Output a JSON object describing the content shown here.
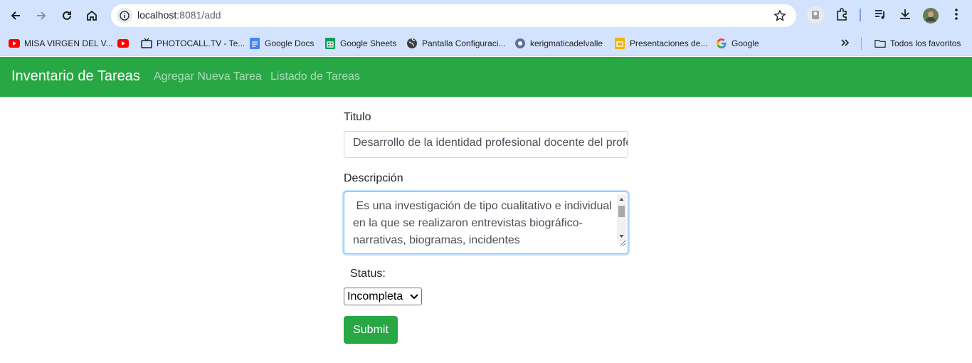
{
  "browser": {
    "url_host": "localhost",
    "url_path": ":8081/add",
    "bookmarks": [
      {
        "label": "MISA VIRGEN DEL V...",
        "icon": "youtube-icon"
      },
      {
        "label": "",
        "icon": "youtube-icon"
      },
      {
        "label": "PHOTOCALL.TV - Te...",
        "icon": "tv-icon"
      },
      {
        "label": "Google Docs",
        "icon": "docs-icon"
      },
      {
        "label": "Google Sheets",
        "icon": "sheets-icon"
      },
      {
        "label": "Pantalla Configuraci...",
        "icon": "globe-icon"
      },
      {
        "label": "kerigmaticadelvalle",
        "icon": "site-icon"
      },
      {
        "label": "Presentaciones de...",
        "icon": "slides-icon"
      },
      {
        "label": "Google",
        "icon": "google-icon"
      }
    ],
    "all_bookmarks_label": "Todos los favoritos"
  },
  "navbar": {
    "brand": "Inventario de Tareas",
    "links": [
      "Agregar Nueva Tarea",
      "Listado de Tareas"
    ]
  },
  "form": {
    "title_label": "Titulo",
    "title_value": "Desarrollo de la identidad profesional docente del profesorado",
    "description_label": "Descripción",
    "description_value": " Es una investigación de tipo cualitativo e individual en la que se realizaron entrevistas biográfico-narrativas, biogramas, incidentes",
    "status_label": "Status:",
    "status_value": "Incompleta",
    "submit_label": "Submit"
  },
  "colors": {
    "navbar": "#28a745",
    "chrome": "#d3e3fd"
  }
}
